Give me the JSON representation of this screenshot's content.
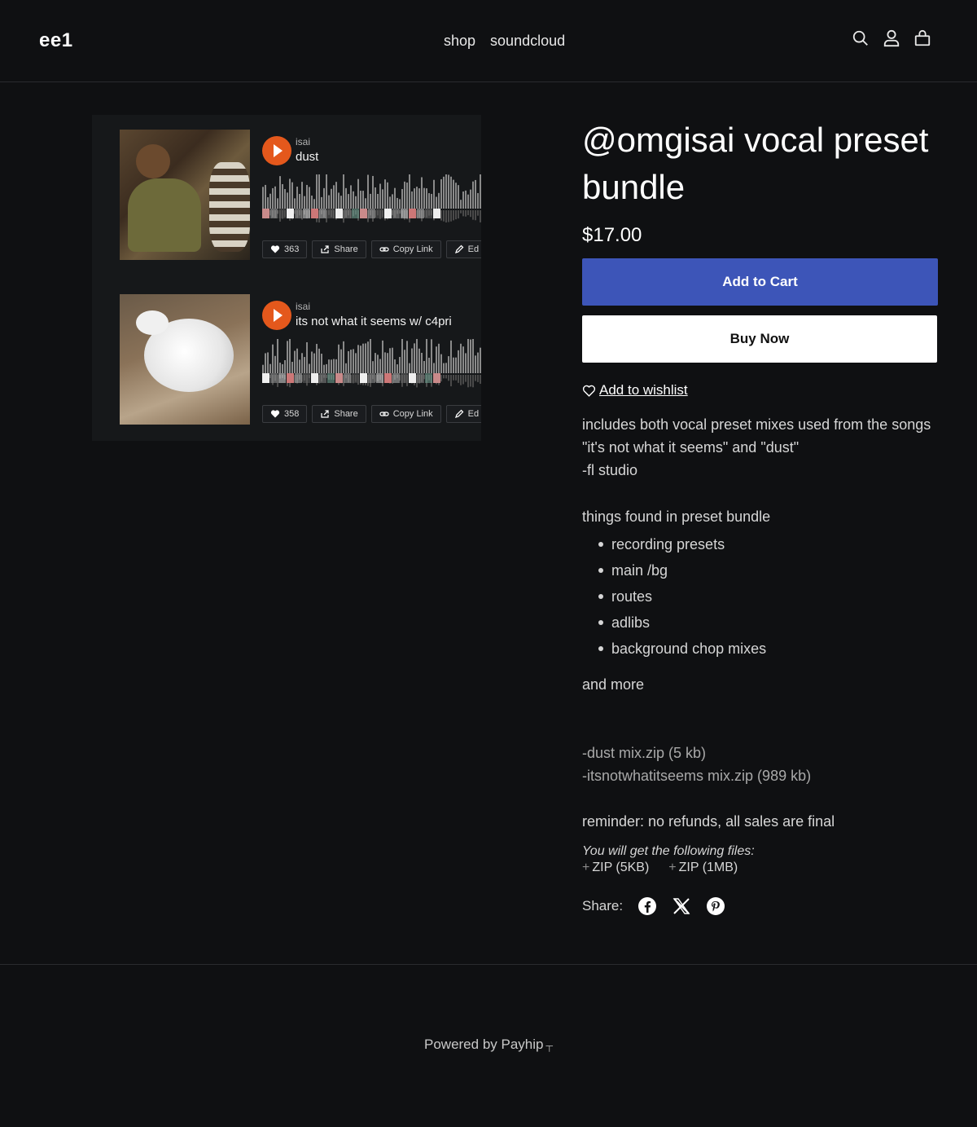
{
  "header": {
    "logo": "ee1",
    "nav": [
      "shop",
      "soundcloud"
    ],
    "icons": [
      "search-icon",
      "account-icon",
      "cart-icon"
    ]
  },
  "tracks": [
    {
      "artist": "isai",
      "title": "dust",
      "likes": "363",
      "share_label": "Share",
      "copy_label": "Copy Link",
      "edit_label": "Ed"
    },
    {
      "artist": "isai",
      "title": "its not what it seems w/ c4pri",
      "likes": "358",
      "share_label": "Share",
      "copy_label": "Copy Link",
      "edit_label": "Ed"
    }
  ],
  "product": {
    "title": "@omgisai vocal preset bundle",
    "price": "$17.00",
    "add_to_cart": "Add to Cart",
    "buy_now": "Buy Now",
    "wishlist": "Add to wishlist",
    "desc_line1": "includes both vocal preset mixes used from the songs \"it's not what it seems\" and \"dust\"",
    "desc_line2": "-fl studio",
    "found_heading": "things found in preset bundle",
    "found_items": [
      "recording presets",
      "main /bg",
      "routes",
      "adlibs",
      "background chop mixes"
    ],
    "and_more": "and more",
    "file1": "-dust mix.zip (5 kb)",
    "file2": "-itsnotwhatitseems mix.zip (989 kb)",
    "reminder": "reminder: no refunds, all sales are final",
    "you_get": "You will get the following files:",
    "files": [
      "ZIP (5KB)",
      "ZIP (1MB)"
    ],
    "share_label": "Share:"
  },
  "footer": {
    "powered_by": "Powered by Payhip"
  },
  "colors": {
    "background": "#0f1012",
    "accent_button": "#3d55b8",
    "play_button": "#e4581c"
  }
}
